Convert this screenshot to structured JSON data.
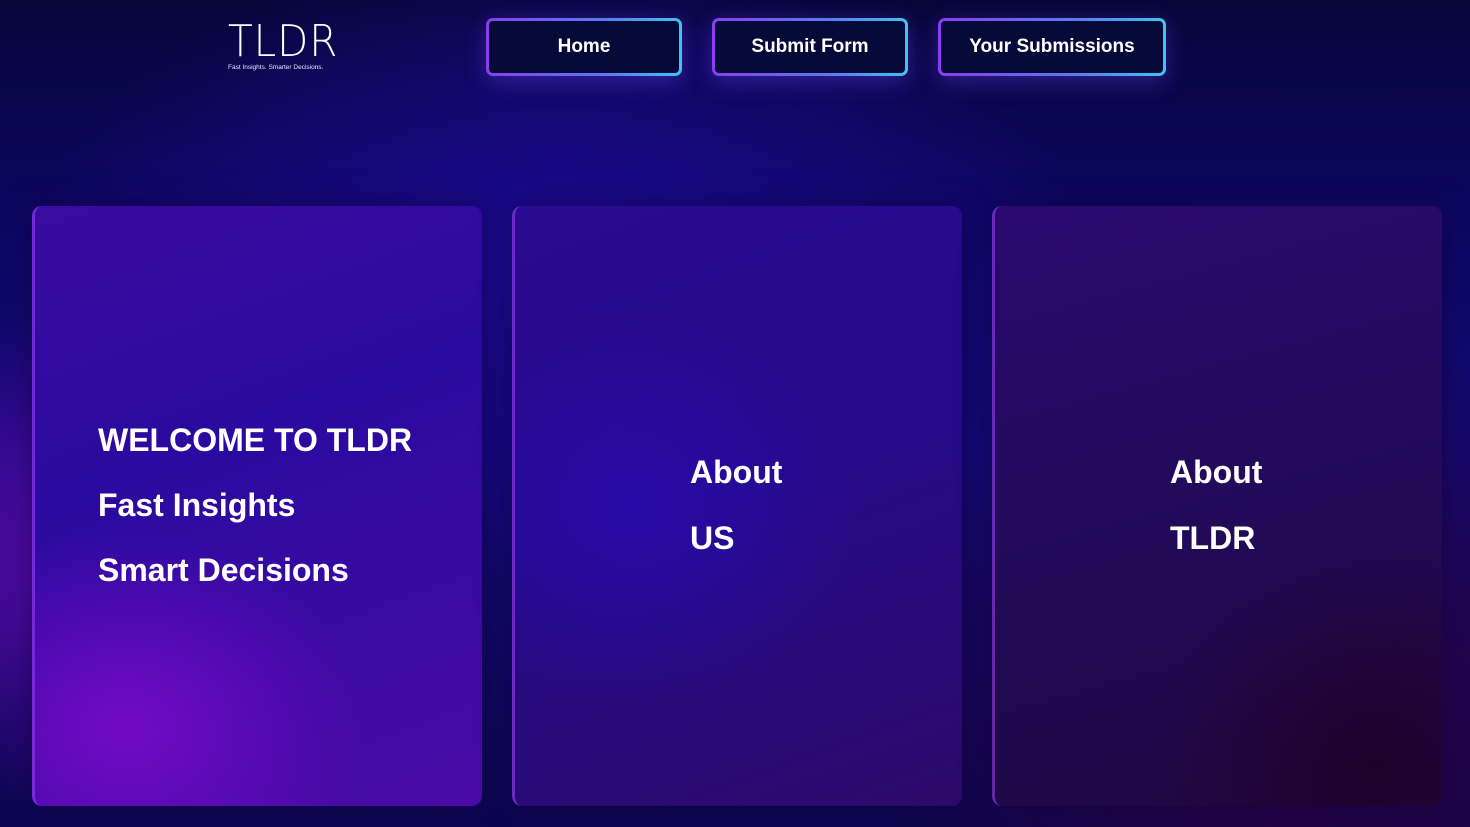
{
  "header": {
    "logo": {
      "mark": "TLDR",
      "tagline": "Fast Insights. Smarter Decisions."
    },
    "nav": [
      {
        "label": "Home"
      },
      {
        "label": "Submit Form"
      },
      {
        "label": "Your Submissions"
      }
    ]
  },
  "cards": {
    "welcome": {
      "lines": [
        "WELCOME TO TLDR",
        "Fast Insights",
        "Smart Decisions"
      ]
    },
    "about_us": {
      "lines": [
        "About",
        "US"
      ]
    },
    "about_tldr": {
      "lines": [
        "About",
        "TLDR"
      ]
    }
  },
  "colors": {
    "button_border_start": "#8c3cf0",
    "button_border_end": "#3fc4f0",
    "button_fill": "#060a38",
    "background": "#0b0660",
    "text": "#ffffff"
  }
}
